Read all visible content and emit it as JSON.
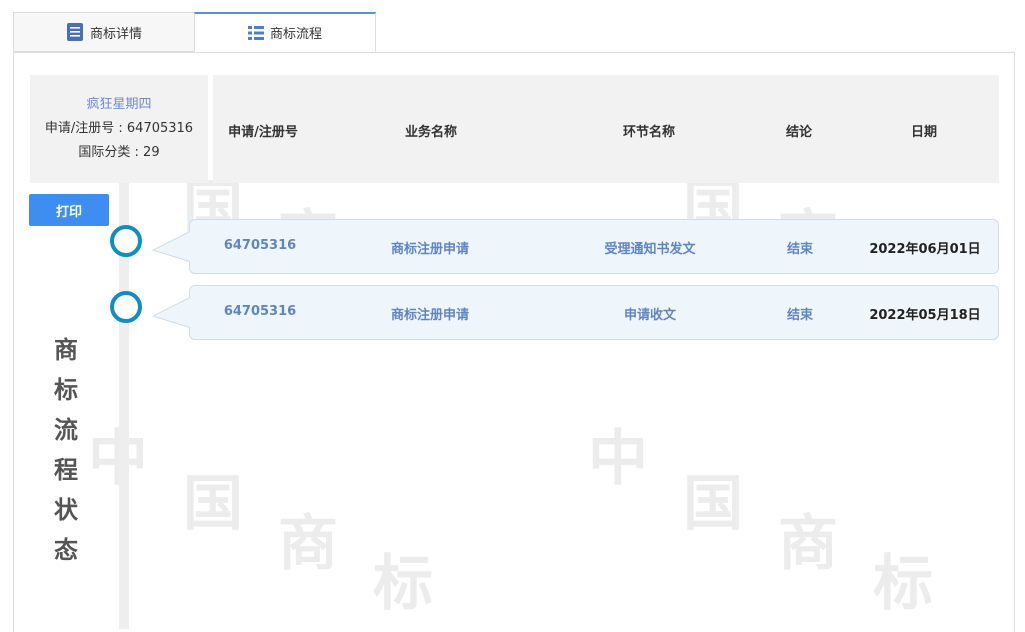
{
  "tabs": [
    {
      "label": "商标详情",
      "icon": "document-icon"
    },
    {
      "label": "商标流程",
      "icon": "list-icon"
    }
  ],
  "info": {
    "name": "疯狂星期四",
    "reg_number": "申请/注册号 : 64705316",
    "class": "国际分类 : 29"
  },
  "table": {
    "headers": [
      "申请/注册号",
      "业务名称",
      "环节名称",
      "结论",
      "日期"
    ],
    "rows": [
      {
        "reg": "64705316",
        "business": "商标注册申请",
        "step": "受理通知书发文",
        "result": "结束",
        "date": "2022年06月01日"
      },
      {
        "reg": "64705316",
        "business": "商标注册申请",
        "step": "申请收文",
        "result": "结束",
        "date": "2022年05月18日"
      }
    ]
  },
  "print_label": "打印",
  "status_title": [
    "商",
    "标",
    "流",
    "程",
    "状",
    "态"
  ],
  "watermark": [
    "中",
    "国",
    "商",
    "标"
  ],
  "colors": {
    "accent": "#3d8ef0",
    "circle": "#0e8fc2",
    "tab_active": "#5b8fd9",
    "row_text": "#5f86c4"
  }
}
